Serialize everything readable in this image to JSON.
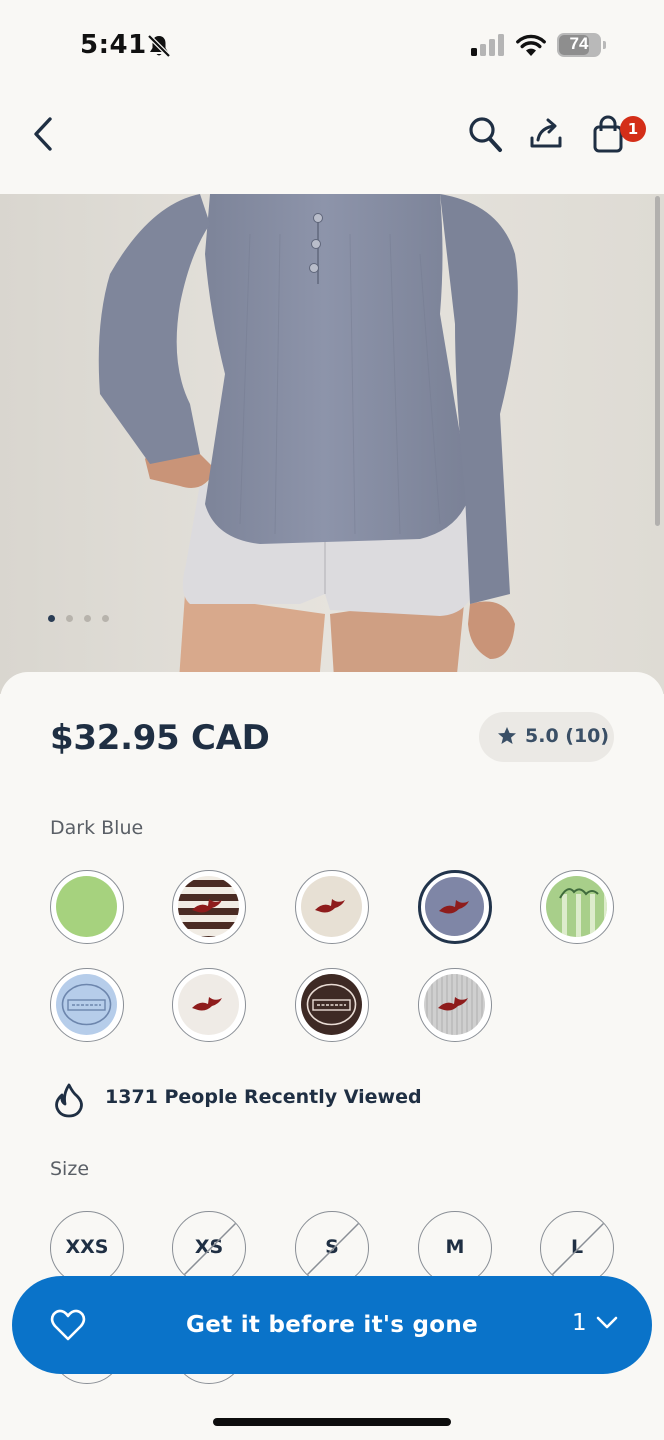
{
  "status_bar": {
    "time": "5:41",
    "battery": "74",
    "icons": [
      "bell-slash-icon",
      "signal-icon",
      "wifi-icon",
      "battery-icon"
    ]
  },
  "nav": {
    "icons": [
      "chevron-left-icon",
      "search-icon",
      "share-icon",
      "shopping-bag-icon"
    ],
    "cart_count": "1"
  },
  "gallery": {
    "page_count": 4,
    "active_index": 0
  },
  "product": {
    "price": "$32.95 CAD",
    "rating": "5.0 (10)",
    "selected_color": "Dark Blue",
    "swatches": [
      {
        "colors": [
          "#a6d27e"
        ],
        "pattern": "solid"
      },
      {
        "colors": [
          "#f1ece4",
          "#4a2b23",
          "#8e1c1c"
        ],
        "pattern": "stripes-logo"
      },
      {
        "colors": [
          "#e7e0d4",
          "#8e1c1c"
        ],
        "pattern": "logo"
      },
      {
        "colors": [
          "#7f86a6",
          "#8e1c1c"
        ],
        "pattern": "logo",
        "selected": true
      },
      {
        "colors": [
          "#a8cf8a",
          "#eaf2dc"
        ],
        "pattern": "script"
      },
      {
        "colors": [
          "#b6cdea",
          "#6d86ad"
        ],
        "pattern": "badge"
      },
      {
        "colors": [
          "#efebe6",
          "#8e1c1c"
        ],
        "pattern": "logo"
      },
      {
        "colors": [
          "#3e2a25",
          "#e9dcd5"
        ],
        "pattern": "badge"
      },
      {
        "colors": [
          "#cfcfcf",
          "#8e1c1c"
        ],
        "pattern": "heather-logo"
      }
    ],
    "viewed_text": "1371 People Recently Viewed",
    "size_heading": "Size",
    "sizes": [
      {
        "label": "XXS",
        "available": true
      },
      {
        "label": "XS",
        "available": false
      },
      {
        "label": "S",
        "available": false
      },
      {
        "label": "M",
        "available": true
      },
      {
        "label": "L",
        "available": false
      }
    ]
  },
  "cta": {
    "label": "Get it before it's gone",
    "quantity": "1"
  },
  "colors": {
    "primary_blue": "#0a73c9",
    "badge_red": "#d42e18",
    "text_navy": "#1f2f43"
  }
}
